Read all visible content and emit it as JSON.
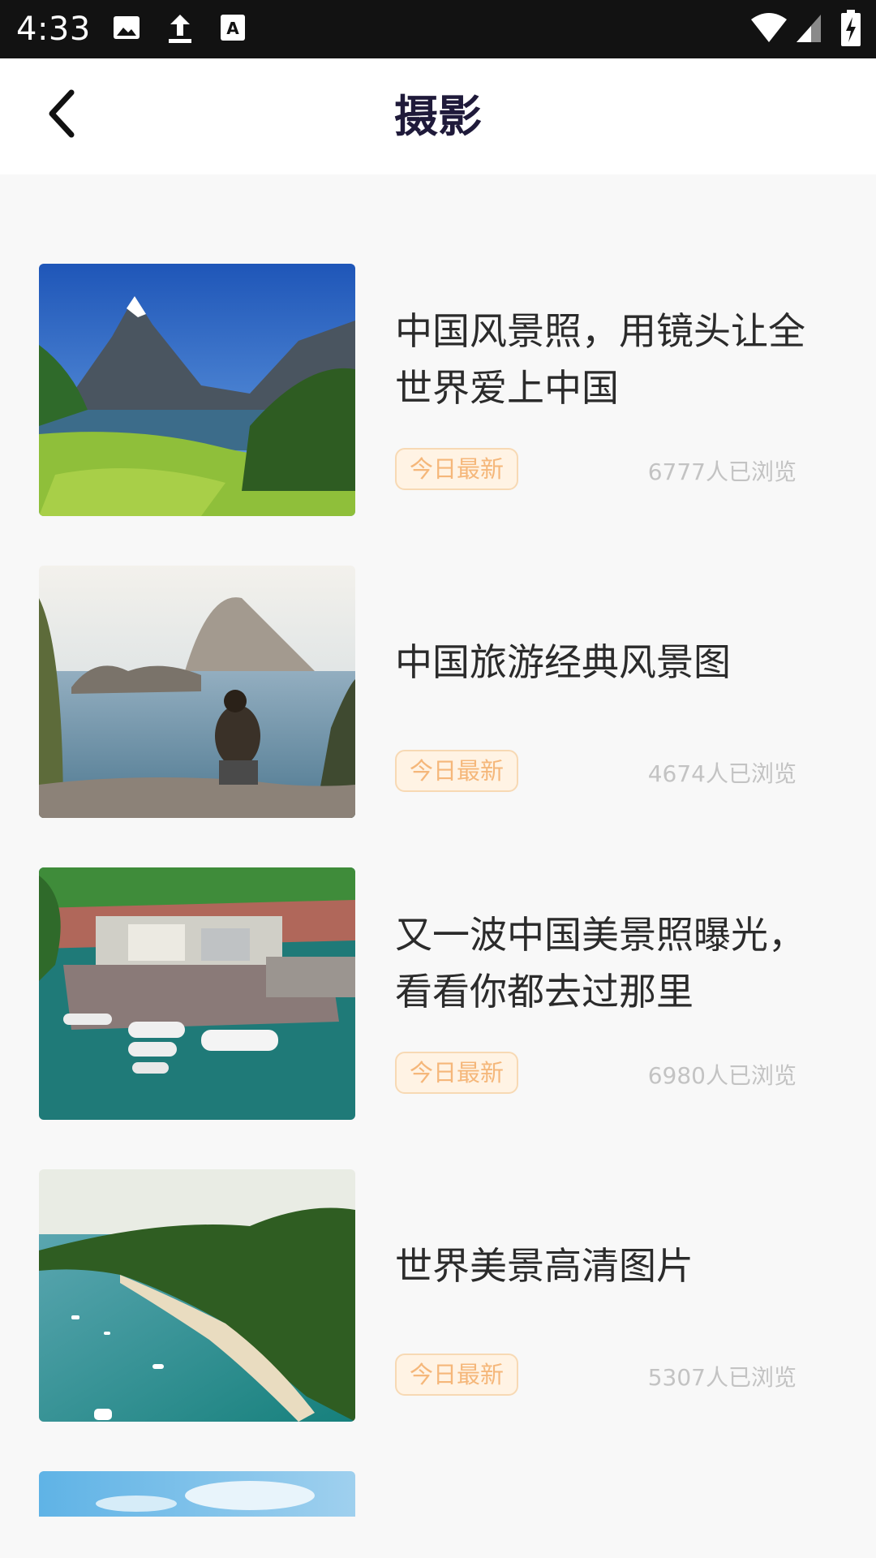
{
  "status_bar": {
    "time": "4:33",
    "left_icons": [
      "image-icon",
      "upload-icon",
      "keyboard-a-icon"
    ],
    "right_icons": [
      "wifi-icon",
      "cell-signal-icon",
      "battery-charging-icon"
    ]
  },
  "header": {
    "title": "摄影",
    "back_icon": "chevron-left-icon"
  },
  "articles": [
    {
      "title": "中国风景照，用镜头让全世界爱上中国",
      "badge": "今日最新",
      "views": "6777人已浏览"
    },
    {
      "title": "中国旅游经典风景图",
      "badge": "今日最新",
      "views": "4674人已浏览"
    },
    {
      "title": "又一波中国美景照曝光，看看你都去过那里",
      "badge": "今日最新",
      "views": "6980人已浏览"
    },
    {
      "title": "世界美景高清图片",
      "badge": "今日最新",
      "views": "5307人已浏览"
    }
  ],
  "colors": {
    "status_bar_bg": "#121212",
    "header_bg": "#ffffff",
    "page_bg": "#f8f8f8",
    "title_color": "#1f1a3a",
    "badge_bg": "#fff3e4",
    "badge_text": "#f5b77a",
    "views_text": "#c3c3c3"
  }
}
